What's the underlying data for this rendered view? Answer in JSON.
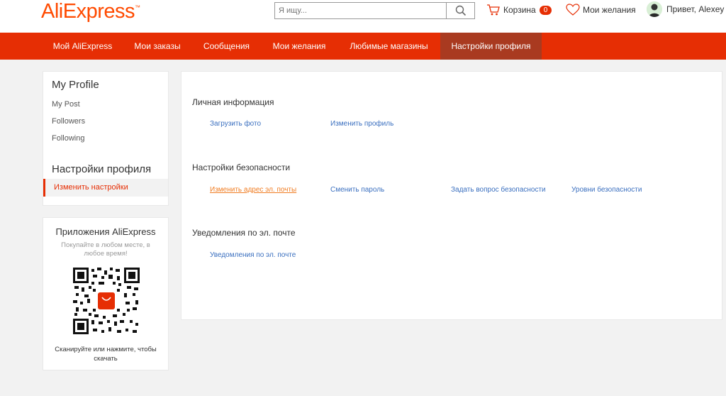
{
  "header": {
    "logo_text": "AliExpress",
    "logo_mark": "™",
    "search_placeholder": "Я ищу...",
    "cart_label": "Корзина",
    "cart_count": "0",
    "wishlist_label": "Мои желания",
    "greeting": "Привет, Alexey"
  },
  "nav": {
    "items": [
      {
        "label": "Мой AliExpress"
      },
      {
        "label": "Мои заказы"
      },
      {
        "label": "Сообщения"
      },
      {
        "label": "Мои желания"
      },
      {
        "label": "Любимые магазины"
      },
      {
        "label": "Настройки профиля"
      }
    ]
  },
  "sidebar": {
    "profile_title": "My Profile",
    "links": [
      "My Post",
      "Followers",
      "Following"
    ],
    "settings_title": "Настройки профиля",
    "active_link": "Изменить настройки"
  },
  "app_promo": {
    "title": "Приложения AliExpress",
    "subtitle": "Покупайте в любом месте, в любое время!",
    "footer": "Сканируйте или нажмите, чтобы скачать"
  },
  "main": {
    "personal_title": "Личная информация",
    "personal_links": [
      "Загрузить фото",
      "Изменить профиль"
    ],
    "security_title": "Настройки безопасности",
    "security_links": [
      "Изменить адрес эл. почты",
      "Сменить пароль",
      "Задать вопрос безопасности",
      "Уровни безопасности"
    ],
    "email_title": "Уведомления по эл. почте",
    "email_links": [
      "Уведомления по эл. почте"
    ]
  },
  "colors": {
    "brand": "#e62e04",
    "nav_active": "#a93a20",
    "link": "#3a6fbf",
    "link_hover": "#f07c21"
  }
}
